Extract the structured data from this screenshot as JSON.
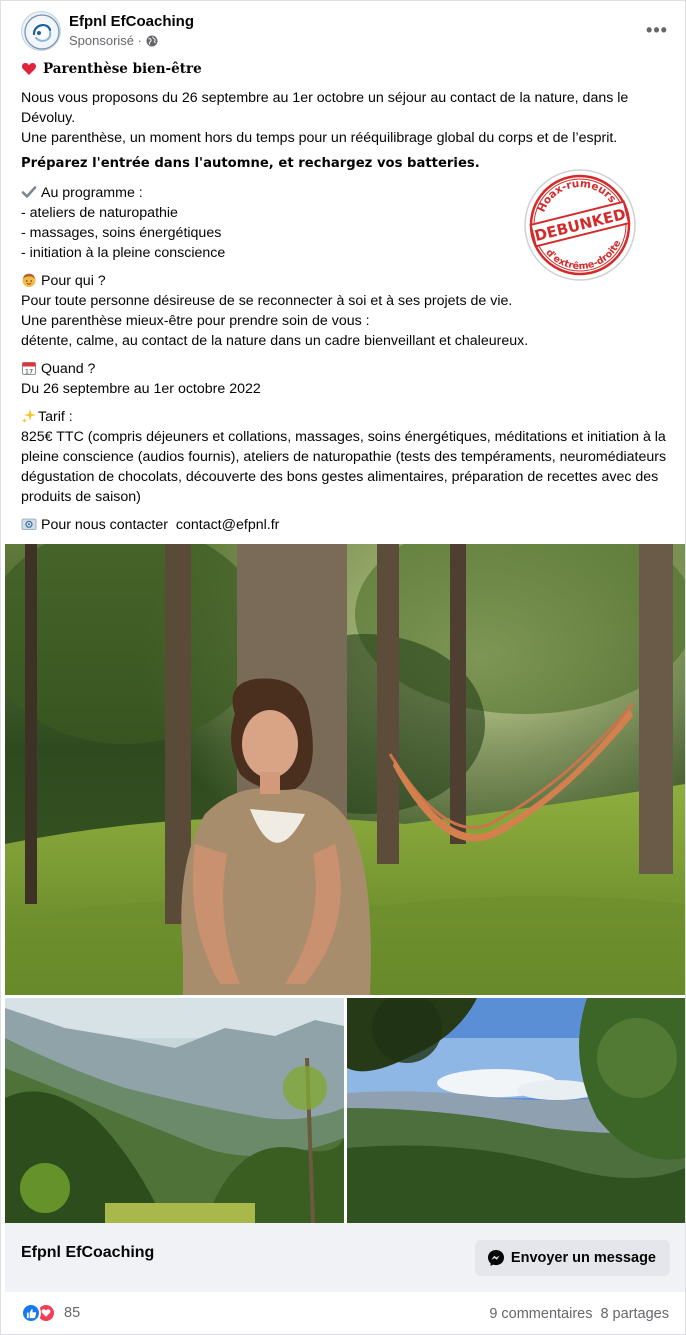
{
  "header": {
    "page_name": "Efpnl EfCoaching",
    "sponsored": "Sponsorisé ·",
    "more": "•••"
  },
  "post": {
    "heading": "Parenthèse bien-être",
    "intro_1": "Nous vous proposons du 26 septembre au 1er octobre un séjour au contact de la nature, dans le Dévoluy.",
    "intro_2": "Une parenthèse, un moment hors du temps pour un rééquilibrage global du corps et de l’esprit.",
    "tagline": "Préparez l'entrée dans l'automne, et rechargez vos batteries.",
    "programme_title": "Au programme :",
    "programme_items": [
      "- ateliers de naturopathie",
      "- massages, soins énergétiques",
      "- initiation à la pleine conscience"
    ],
    "who_title": "Pour qui ?",
    "who_lines": [
      "Pour toute personne désireuse de se reconnecter à soi et à ses projets de vie.",
      "Une parenthèse mieux-être pour prendre soin de vous :",
      "détente, calme, au contact de la nature dans un cadre bienveillant et chaleureux."
    ],
    "when_title": "Quand ?",
    "when_text": "Du 26 septembre au 1er octobre 2022",
    "price_title": "Tarif :",
    "price_text": "825€ TTC (compris déjeuners et collations, massages, soins énergétiques, méditations et initiation à la pleine conscience (audios fournis), ateliers de naturopathie (tests des tempéraments, neuromédiateurs dégustation de chocolats, découverte des bons gestes alimentaires, préparation de recettes avec des produits de saison)",
    "contact_label": "Pour nous contacter",
    "contact_email": "contact@efpnl.fr"
  },
  "stamp": {
    "top_text": "Hoax-rumeurs",
    "center_text": "DEBUNKED",
    "bottom_text": "d'extrême-droite",
    "color": "#d42a2a"
  },
  "cta": {
    "name": "Efpnl EfCoaching",
    "button_label": "Envoyer un message"
  },
  "footer": {
    "reaction_count": "85",
    "comments": "9 commentaires",
    "shares": "8 partages"
  },
  "colors": {
    "text": "#050505",
    "secondary": "#65676b",
    "cta_bg": "#f0f2f5",
    "like": "#1877f2",
    "love": "#f33e58"
  }
}
